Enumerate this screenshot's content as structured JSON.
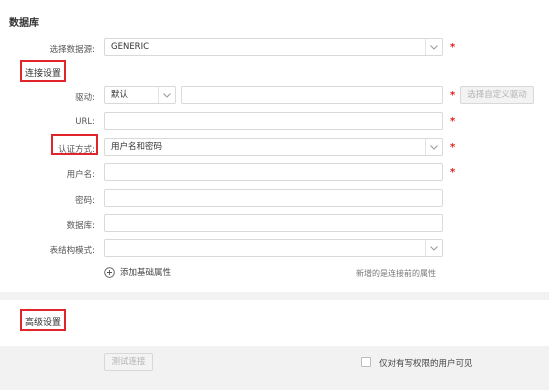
{
  "page": {
    "title": "数据库"
  },
  "datasource": {
    "label": "选择数据源:",
    "value": "GENERIC"
  },
  "connection": {
    "section_title": "连接设置",
    "driver": {
      "label": "驱动:",
      "type_value": "默认",
      "path_value": "",
      "custom_button": "选择自定义驱动"
    },
    "url": {
      "label": "URL:",
      "value": ""
    },
    "auth": {
      "label": "认证方式:",
      "value": "用户名和密码"
    },
    "username": {
      "label": "用户名:",
      "value": ""
    },
    "password": {
      "label": "密码:",
      "value": ""
    },
    "database": {
      "label": "数据库:",
      "value": ""
    },
    "schema": {
      "label": "表结构模式:",
      "value": ""
    },
    "add_property": {
      "icon": "plus-circle-icon",
      "label": "添加基础属性"
    },
    "note": "新增的是连接前的属性"
  },
  "advanced": {
    "section_title": "高级设置"
  },
  "footer": {
    "test_button": "测试连接",
    "write_only_label": "仅对有写权限的用户可见",
    "write_only_checked": false
  },
  "colors": {
    "required": "#e02020",
    "highlight": "#e0252b",
    "border": "#d9d9d9"
  }
}
